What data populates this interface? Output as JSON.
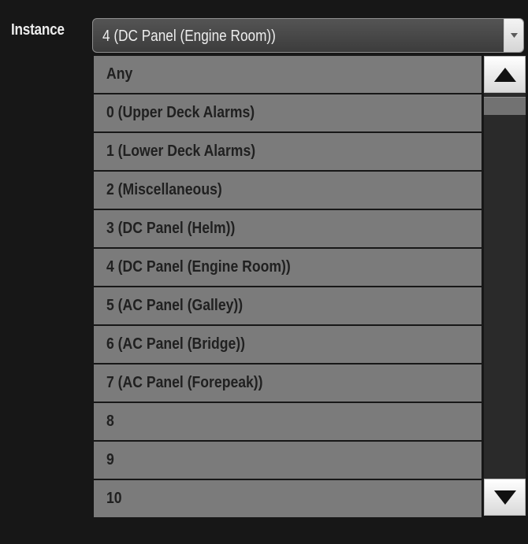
{
  "field": {
    "label": "Instance",
    "selected_value": "4 (DC Panel (Engine Room))"
  },
  "dropdown": {
    "options": [
      "Any",
      "0 (Upper Deck Alarms)",
      "1 (Lower Deck Alarms)",
      "2 (Miscellaneous)",
      "3 (DC Panel (Helm))",
      "4 (DC Panel (Engine Room))",
      "5 (AC Panel (Galley))",
      "6 (AC Panel (Bridge))",
      "7 (AC Panel (Forepeak))",
      "8",
      "9",
      "10"
    ]
  },
  "icons": {
    "select_arrow": "chevron-down-icon",
    "scroll_up": "triangle-up-icon",
    "scroll_down": "triangle-down-icon"
  },
  "colors": {
    "background": "#171717",
    "option_fill": "#7b7b7b",
    "option_text": "#202020",
    "label_text": "#ececec"
  }
}
